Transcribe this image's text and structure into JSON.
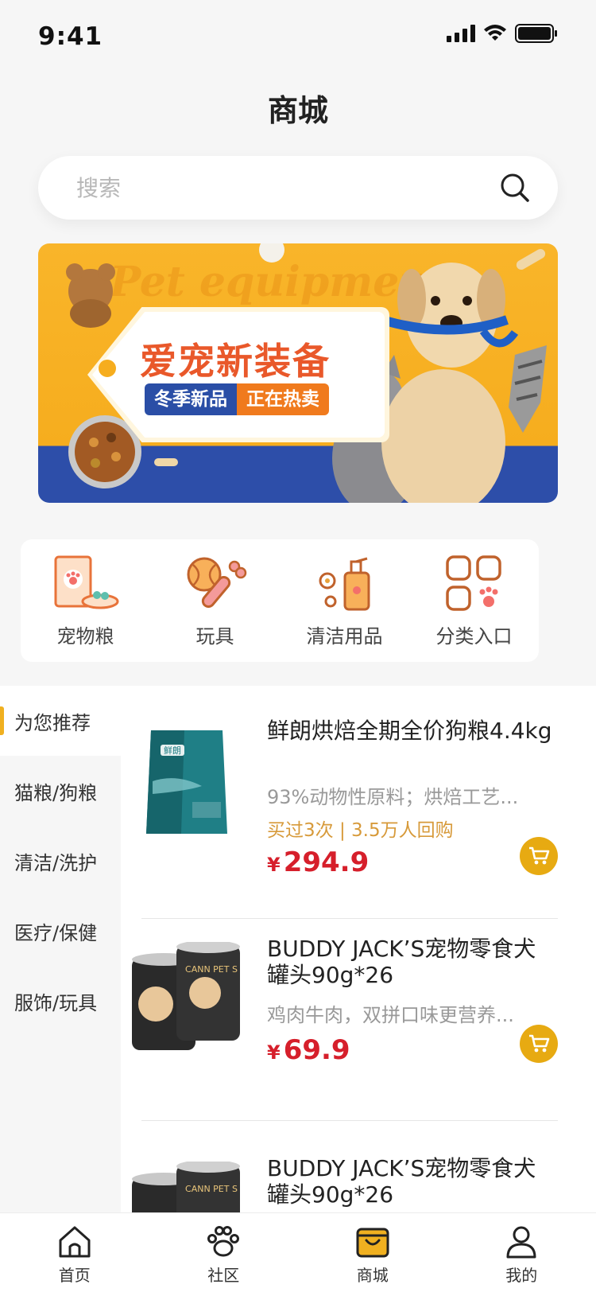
{
  "status": {
    "time": "9:41"
  },
  "page": {
    "title": "商城"
  },
  "search": {
    "placeholder": "搜索"
  },
  "banner": {
    "bg_text": "Pet equipment",
    "title": "爱宠新装备",
    "tag_left": "冬季新品",
    "tag_right": "正在热卖"
  },
  "categories": [
    {
      "label": "宠物粮",
      "icon": "pet-food-icon"
    },
    {
      "label": "玩具",
      "icon": "toy-icon"
    },
    {
      "label": "清洁用品",
      "icon": "cleaning-icon"
    },
    {
      "label": "分类入口",
      "icon": "category-grid-icon"
    }
  ],
  "sidebar": {
    "items": [
      {
        "label": "为您推荐",
        "active": true
      },
      {
        "label": "猫粮/狗粮"
      },
      {
        "label": "清洁/洗护"
      },
      {
        "label": "医疗/保健"
      },
      {
        "label": "服饰/玩具"
      }
    ]
  },
  "products": [
    {
      "name": "鲜朗烘焙全期全价狗粮4.4kg",
      "desc": "93%动物性原料；烘焙工艺...",
      "meta": "买过3次 | 3.5万人回购",
      "currency": "¥",
      "price": "294.9",
      "pack_brand": "鲜朗"
    },
    {
      "name": "BUDDY JACK’S宠物零食犬罐头90g*26",
      "desc": "鸡肉牛肉，双拼口味更营养...",
      "currency": "¥",
      "price": "69.9",
      "can_text": "CANN PET S"
    },
    {
      "name": "BUDDY JACK’S宠物零食犬罐头90g*26",
      "can_text": "CANN PET S"
    }
  ],
  "tabbar": {
    "items": [
      {
        "label": "首页",
        "icon": "home-icon"
      },
      {
        "label": "社区",
        "icon": "paw-icon"
      },
      {
        "label": "商城",
        "icon": "shop-bag-icon",
        "active": true
      },
      {
        "label": "我的",
        "icon": "user-icon"
      }
    ]
  },
  "colors": {
    "accent": "#e7aa12",
    "price": "#d61f2b",
    "meta": "#d79a3a",
    "banner_orange": "#f6ad1e",
    "banner_blue": "#2d4ea9"
  }
}
